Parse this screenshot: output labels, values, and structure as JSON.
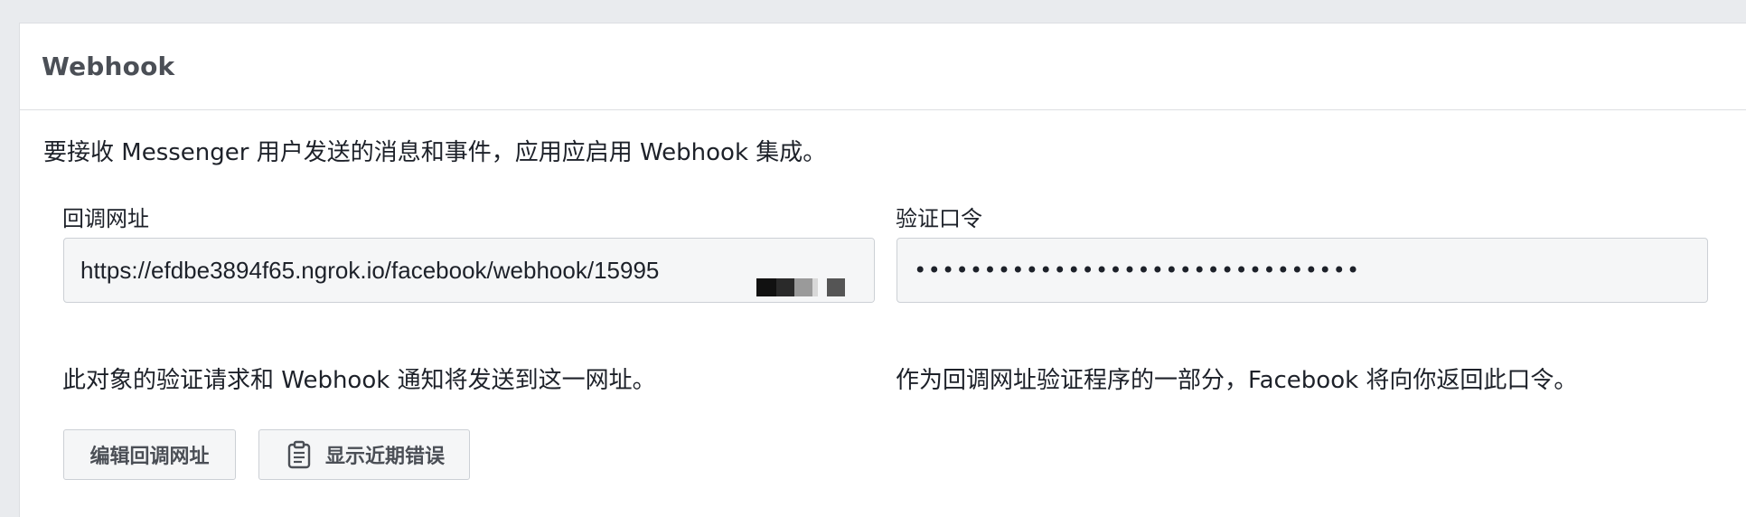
{
  "panel": {
    "title": "Webhook"
  },
  "intro_text": "要接收 Messenger 用户发送的消息和事件，应用应启用 Webhook 集成。",
  "callback_url": {
    "label": "回调网址",
    "value": "https://efdbe3894f65.ngrok.io/facebook/webhook/15995",
    "hint": "此对象的验证请求和 Webhook 通知将发送到这一网址。"
  },
  "verify_token": {
    "label": "验证口令",
    "value": "••••••••••••••••••••••••••••••••",
    "hint": "作为回调网址验证程序的一部分，Facebook 将向你返回此口令。"
  },
  "buttons": {
    "edit_callback": "编辑回调网址",
    "show_errors": "显示近期错误",
    "show_errors_icon": "clipboard-icon"
  }
}
